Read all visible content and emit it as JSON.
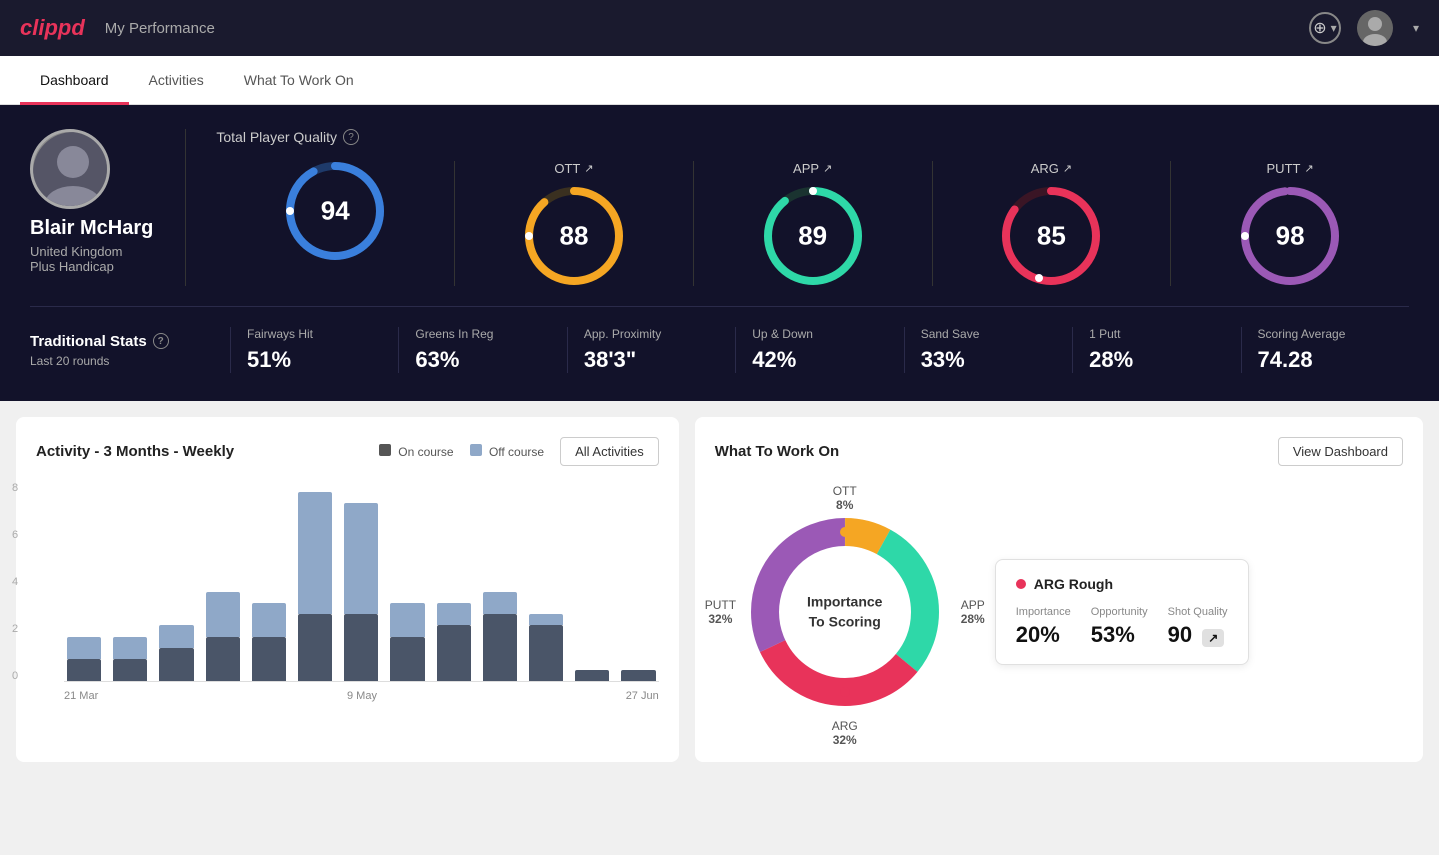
{
  "header": {
    "logo": "clippd",
    "title": "My Performance",
    "add_label": "+",
    "dropdown_arrow": "▾"
  },
  "nav": {
    "tabs": [
      {
        "label": "Dashboard",
        "active": true
      },
      {
        "label": "Activities",
        "active": false
      },
      {
        "label": "What To Work On",
        "active": false
      }
    ]
  },
  "player": {
    "name": "Blair McHarg",
    "country": "United Kingdom",
    "handicap": "Plus Handicap"
  },
  "quality": {
    "title": "Total Player Quality",
    "main_score": 94,
    "metrics": [
      {
        "label": "OTT",
        "value": 88,
        "color": "#f5a623",
        "bg": "#3a3020",
        "circumference": 283,
        "dash": 250
      },
      {
        "label": "APP",
        "value": 89,
        "color": "#2ed8a8",
        "bg": "#1a3330",
        "circumference": 283,
        "dash": 252
      },
      {
        "label": "ARG",
        "value": 85,
        "color": "#e8335a",
        "bg": "#3a1525",
        "circumference": 283,
        "dash": 240
      },
      {
        "label": "PUTT",
        "value": 98,
        "color": "#9b59b6",
        "bg": "#2a1a3a",
        "circumference": 283,
        "dash": 277
      }
    ]
  },
  "stats": {
    "title": "Traditional Stats",
    "subtitle": "Last 20 rounds",
    "items": [
      {
        "label": "Fairways Hit",
        "value": "51%"
      },
      {
        "label": "Greens In Reg",
        "value": "63%"
      },
      {
        "label": "App. Proximity",
        "value": "38'3\""
      },
      {
        "label": "Up & Down",
        "value": "42%"
      },
      {
        "label": "Sand Save",
        "value": "33%"
      },
      {
        "label": "1 Putt",
        "value": "28%"
      },
      {
        "label": "Scoring Average",
        "value": "74.28"
      }
    ]
  },
  "activity_chart": {
    "title": "Activity - 3 Months - Weekly",
    "legend": {
      "on_course": "On course",
      "off_course": "Off course"
    },
    "all_activities_label": "All Activities",
    "x_labels": [
      "21 Mar",
      "9 May",
      "27 Jun"
    ],
    "y_labels": [
      "8",
      "6",
      "4",
      "2",
      "0"
    ],
    "bars": [
      {
        "on": 1,
        "off": 1
      },
      {
        "on": 1,
        "off": 1
      },
      {
        "on": 1.5,
        "off": 1
      },
      {
        "on": 2,
        "off": 2
      },
      {
        "on": 2,
        "off": 1.5
      },
      {
        "on": 3,
        "off": 5.5
      },
      {
        "on": 3,
        "off": 5
      },
      {
        "on": 2,
        "off": 1.5
      },
      {
        "on": 2.5,
        "off": 1
      },
      {
        "on": 3,
        "off": 1
      },
      {
        "on": 2.5,
        "off": 0.5
      },
      {
        "on": 0.5,
        "off": 0
      },
      {
        "on": 0.5,
        "off": 0
      }
    ]
  },
  "what_to_work_on": {
    "title": "What To Work On",
    "view_dashboard_label": "View Dashboard",
    "donut_center": "Importance\nTo Scoring",
    "segments": [
      {
        "label": "OTT",
        "pct": 8,
        "color": "#f5a623"
      },
      {
        "label": "APP",
        "pct": 28,
        "color": "#2ed8a8"
      },
      {
        "label": "ARG",
        "pct": 32,
        "color": "#e8335a"
      },
      {
        "label": "PUTT",
        "pct": 32,
        "color": "#9b59b6"
      }
    ],
    "detail": {
      "title": "ARG Rough",
      "dot_color": "#e8335a",
      "metrics": [
        {
          "label": "Importance",
          "value": "20%"
        },
        {
          "label": "Opportunity",
          "value": "53%"
        },
        {
          "label": "Shot Quality",
          "value": "90"
        }
      ]
    }
  },
  "icons": {
    "info": "?",
    "arrow_up_right": "↗"
  }
}
